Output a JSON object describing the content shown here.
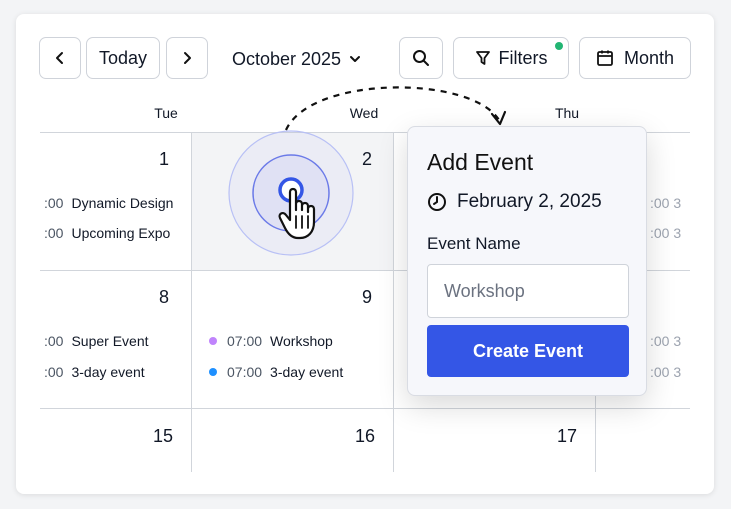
{
  "toolbar": {
    "prev_icon": "chevron-left-icon",
    "today_label": "Today",
    "next_icon": "chevron-right-icon",
    "month_label": "October 2025",
    "search_icon": "search-icon",
    "filters_label": "Filters",
    "view_label": "Month",
    "filter_dot_color": "#22b573"
  },
  "day_headers": [
    "Tue",
    "Wed",
    "Thu"
  ],
  "weeks": [
    {
      "days": [
        "1",
        "2",
        ""
      ]
    },
    {
      "days": [
        "8",
        "9",
        ""
      ]
    },
    {
      "days": [
        "15",
        "16",
        "17"
      ]
    }
  ],
  "events": {
    "tue_1": [
      {
        "time": ":00",
        "title": "Dynamic Design"
      },
      {
        "time": ":00",
        "title": "Upcoming Expo"
      }
    ],
    "tue_8": [
      {
        "time": ":00",
        "title": "Super Event"
      },
      {
        "time": ":00",
        "title": "3-day event"
      }
    ],
    "wed_9": [
      {
        "time": "07:00",
        "title": "Workshop",
        "color": "#c084fc"
      },
      {
        "time": "07:00",
        "title": "3-day event",
        "color": "#1e90ff"
      }
    ],
    "thu_partial": [
      ":00 3",
      ":00 3",
      ":00 3",
      ":00 3"
    ]
  },
  "popover": {
    "title": "Add Event",
    "date": "February 2, 2025",
    "field_label": "Event Name",
    "input_placeholder": "Workshop",
    "submit_label": "Create Event",
    "accent_color": "#3456e6"
  }
}
